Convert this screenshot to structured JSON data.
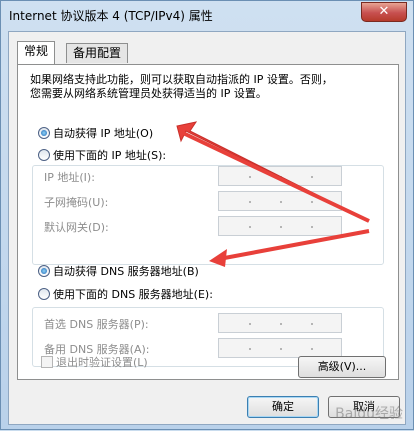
{
  "window": {
    "title": "Internet 协议版本 4 (TCP/IPv4) 属性",
    "close_glyph": "✕"
  },
  "tabs": [
    {
      "label": "常规",
      "active": true
    },
    {
      "label": "备用配置",
      "active": false
    }
  ],
  "general": {
    "intro_line1": "如果网络支持此功能，则可以获取自动指派的 IP 设置。否则，",
    "intro_line2": "您需要从网络系统管理员处获得适当的 IP 设置。",
    "ip_auto_label": "自动获得 IP 地址(O)",
    "ip_manual_label": "使用下面的 IP 地址(S):",
    "ip_mode": "auto",
    "ip_fields": [
      {
        "label": "IP 地址(I):",
        "value": ""
      },
      {
        "label": "子网掩码(U):",
        "value": ""
      },
      {
        "label": "默认网关(D):",
        "value": ""
      }
    ],
    "dns_auto_label": "自动获得 DNS 服务器地址(B)",
    "dns_manual_label": "使用下面的 DNS 服务器地址(E):",
    "dns_mode": "auto",
    "dns_fields": [
      {
        "label": "首选 DNS 服务器(P):",
        "value": ""
      },
      {
        "label": "备用 DNS 服务器(A):",
        "value": ""
      }
    ],
    "validate_on_exit_label": "退出时验证设置(L)",
    "validate_on_exit_checked": false,
    "advanced_button": "高级(V)..."
  },
  "footer": {
    "ok_button": "确定",
    "cancel_button": "取消"
  },
  "annotations": {
    "arrow_color": "#e8403a"
  },
  "watermark": "Baidu经验"
}
